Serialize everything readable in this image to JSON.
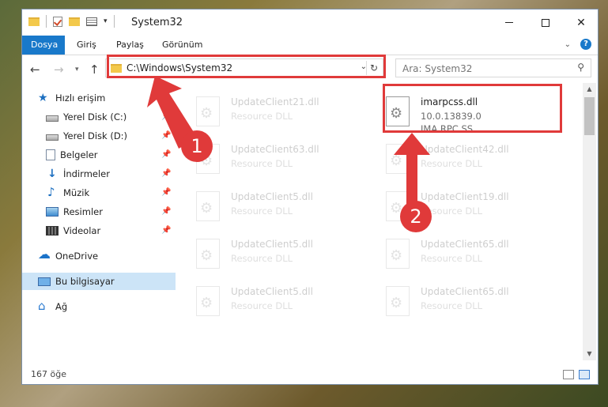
{
  "window": {
    "title": "System32"
  },
  "ribbon": {
    "tabs": [
      "Dosya",
      "Giriş",
      "Paylaş",
      "Görünüm"
    ]
  },
  "address": {
    "path": "C:\\Windows\\System32"
  },
  "search": {
    "placeholder": "Ara: System32"
  },
  "sidebar": {
    "quick_access": "Hızlı erişim",
    "items": [
      {
        "label": "Yerel Disk (C:)",
        "icon": "drive-icon",
        "pinned": true
      },
      {
        "label": "Yerel Disk (D:)",
        "icon": "drive-icon",
        "pinned": true
      },
      {
        "label": "Belgeler",
        "icon": "documents-icon",
        "pinned": true
      },
      {
        "label": "İndirmeler",
        "icon": "downloads-icon",
        "pinned": true
      },
      {
        "label": "Müzik",
        "icon": "music-icon",
        "pinned": true
      },
      {
        "label": "Resimler",
        "icon": "pictures-icon",
        "pinned": true
      },
      {
        "label": "Videolar",
        "icon": "videos-icon",
        "pinned": true
      }
    ],
    "onedrive": "OneDrive",
    "this_pc": "Bu bilgisayar",
    "network": "Ağ"
  },
  "files": {
    "highlighted": {
      "name": "imarpcss.dll",
      "version": "10.0.13839.0",
      "description": "IMA RPC SS"
    },
    "left_column": [
      {
        "name": "UpdateClient21.dll",
        "type": "Resource DLL"
      },
      {
        "name": "UpdateClient63.dll",
        "type": "Resource DLL"
      },
      {
        "name": "UpdateClient5.dll",
        "type": "Resource DLL"
      },
      {
        "name": "UpdateClient5.dll",
        "type": "Resource DLL"
      },
      {
        "name": "UpdateClient5.dll",
        "type": "Resource DLL"
      }
    ],
    "right_column": [
      {
        "name": "UpdateClient42.dll",
        "type": "Resource DLL"
      },
      {
        "name": "UpdateClient19.dll",
        "type": "Resource DLL"
      },
      {
        "name": "UpdateClient65.dll",
        "type": "Resource DLL"
      },
      {
        "name": "UpdateClient65.dll",
        "type": "Resource DLL"
      }
    ]
  },
  "status": {
    "item_count": "167 öğe"
  },
  "annotations": {
    "step1": "1",
    "step2": "2",
    "color": "#e03a3a"
  }
}
